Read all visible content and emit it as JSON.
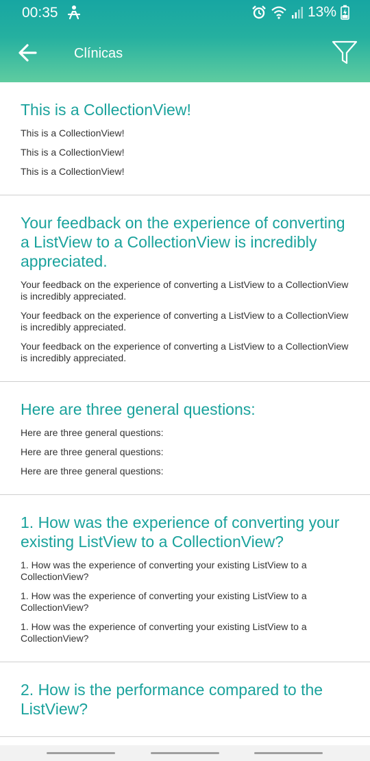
{
  "status_bar": {
    "time": "00:35",
    "battery_percent": "13%",
    "icons": [
      "person-icon",
      "alarm-icon",
      "wifi-icon",
      "signal-icon",
      "battery-charging-icon"
    ]
  },
  "app_bar": {
    "title": "Clínicas",
    "back_icon": "arrow-left-icon",
    "filter_icon": "filter-icon",
    "colors": {
      "gradient_top": "#17a6a2",
      "gradient_bottom": "#5fcca0",
      "accent_text": "#1aa29c"
    }
  },
  "groups": [
    {
      "title": "This is a CollectionView!",
      "lines": [
        "This is a CollectionView!",
        "This is a CollectionView!",
        "This is a CollectionView!"
      ]
    },
    {
      "title": "Your feedback on the experience of converting a ListView to a CollectionView is incredibly appreciated.",
      "lines": [
        "Your feedback on the experience of converting a ListView to a CollectionView is incredibly appreciated.",
        "Your feedback on the experience of converting a ListView to a CollectionView is incredibly appreciated.",
        "Your feedback on the experience of converting a ListView to a CollectionView is incredibly appreciated."
      ]
    },
    {
      "title": "Here are three general questions:",
      "lines": [
        "Here are three general questions:",
        "Here are three general questions:",
        "Here are three general questions:"
      ]
    },
    {
      "title": "1. How was the experience of converting your existing ListView to a CollectionView?",
      "lines": [
        "1. How was the experience of converting your existing ListView to a CollectionView?",
        "1. How was the experience of converting your existing ListView to a CollectionView?",
        "1. How was the experience of converting your existing ListView to a CollectionView?"
      ]
    },
    {
      "title": "2. How is the performance compared to the ListView?",
      "lines": []
    }
  ]
}
